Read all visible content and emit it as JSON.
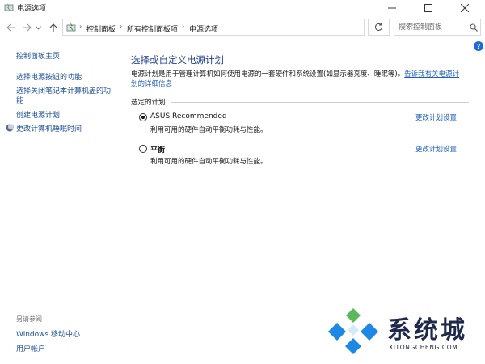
{
  "window": {
    "title": "电源选项"
  },
  "address_bar": {
    "breadcrumbs": [
      "控制面板",
      "所有控制面板项",
      "电源选项"
    ]
  },
  "search": {
    "placeholder": "搜索控制面板"
  },
  "help": {
    "label": "?"
  },
  "left_pane": {
    "home": "控制面板主页",
    "links": [
      "选择电源按钮的功能",
      "选择关闭笔记本计算机盖的功",
      "能",
      "创建电源计划",
      "更改计算机睡眠时间"
    ],
    "see_also_label": "另请参阅",
    "see_also_links": [
      "Windows 移动中心",
      "用户帐户"
    ]
  },
  "main": {
    "heading": "选择或自定义电源计划",
    "description": "电源计划是用于管理计算机如何使用电源的一套硬件和系统设置(如显示器亮度、睡眠等)。",
    "description_link_line1": "告诉我有关电源计",
    "description_link_line2": "划的详细信息",
    "group_label": "选定的计划",
    "plans": [
      {
        "name": "ASUS Recommended",
        "description": "利用可用的硬件自动平衡功耗与性能。",
        "link": "更改计划设置",
        "selected": true
      },
      {
        "name": "平衡",
        "description": "利用可用的硬件自动平衡功耗与性能。",
        "link": "更改计划设置",
        "selected": false
      }
    ]
  },
  "watermark": {
    "text": "系统城",
    "subtext": "XITONGCHENG.COM"
  },
  "colors": {
    "link": "#1f5fc4",
    "heading": "#1f3f8f",
    "watermark_blue": "#1e88e5",
    "watermark_green": "#5cb85c"
  }
}
